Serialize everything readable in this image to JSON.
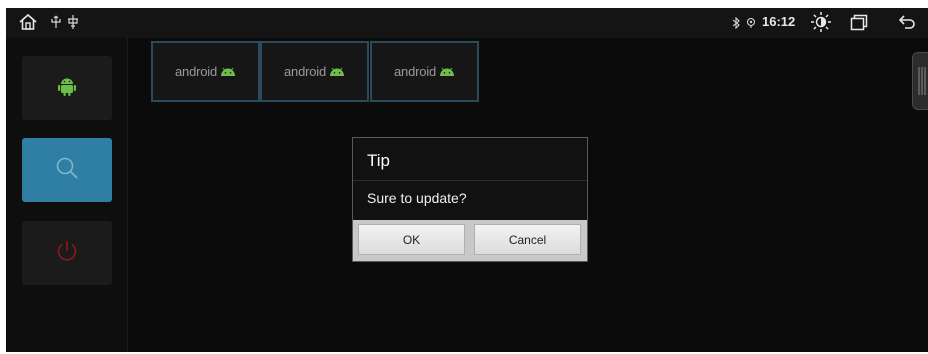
{
  "statusbar": {
    "time": "16:12",
    "icons": [
      "home-icon",
      "usb-icon",
      "bluetooth-icon",
      "location-icon",
      "brightness-icon",
      "recent-apps-icon",
      "back-icon"
    ]
  },
  "sidebar": {
    "items": [
      {
        "icon": "android-icon",
        "color": "#6cc04a"
      },
      {
        "icon": "search-icon",
        "color": "#2f7ea3",
        "active": true
      },
      {
        "icon": "power-icon",
        "color": "#8a1a1a"
      }
    ]
  },
  "thumbnails": [
    {
      "label": "android"
    },
    {
      "label": "android"
    },
    {
      "label": "android"
    }
  ],
  "dialog": {
    "title": "Tip",
    "message": "Sure to update?",
    "ok_label": "OK",
    "cancel_label": "Cancel"
  },
  "colors": {
    "accent": "#2f7ea3",
    "thumb_border": "#2b4a5c",
    "android_green": "#6cc04a"
  }
}
